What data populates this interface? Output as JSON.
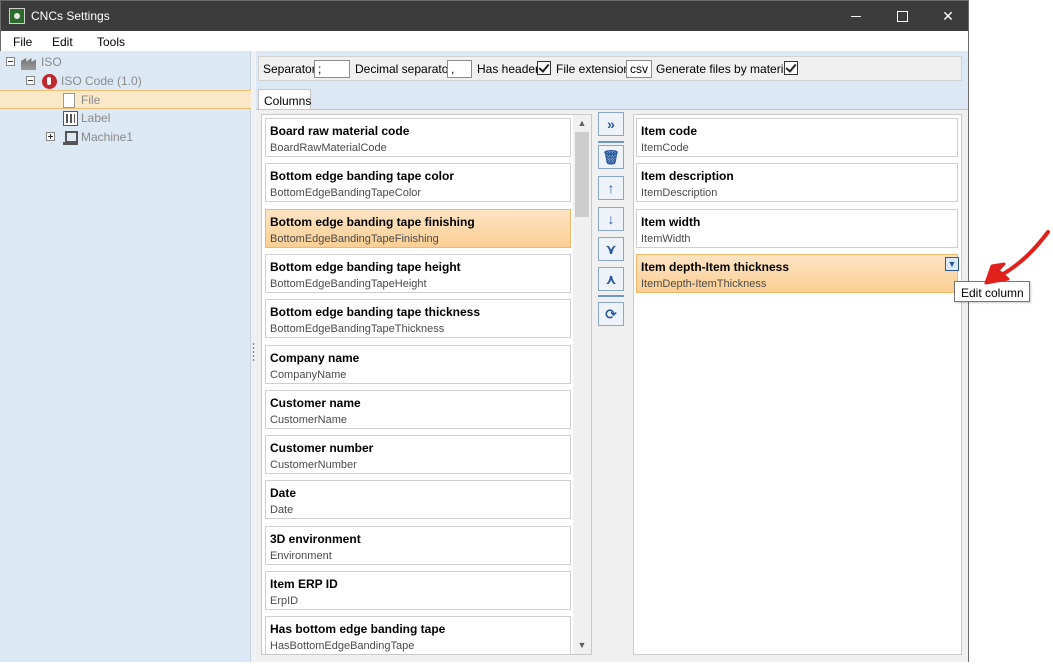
{
  "window": {
    "title": "CNCs Settings"
  },
  "menu": [
    "File",
    "Edit",
    "Tools"
  ],
  "tree": [
    {
      "label": "ISO",
      "icon": "factory-icon"
    },
    {
      "label": "ISO Code (1.0)",
      "icon": "iso-code-icon"
    },
    {
      "label": "File",
      "icon": "file-icon"
    },
    {
      "label": "Label",
      "icon": "label-icon"
    },
    {
      "label": "Machine1",
      "icon": "machine-icon"
    }
  ],
  "toolbar": {
    "separator_label": "Separator",
    "separator_value": ";",
    "decimal_label": "Decimal separator",
    "decimal_value": ",",
    "has_header_label": "Has header",
    "has_header_checked": true,
    "extension_label": "File extension",
    "extension_value": "csv",
    "generate_label": "Generate files by material",
    "generate_checked": true
  },
  "tabs": [
    "Columns"
  ],
  "available_columns": [
    {
      "title": "Board raw material code",
      "key": "BoardRawMaterialCode"
    },
    {
      "title": "Bottom edge banding tape color",
      "key": "BottomEdgeBandingTapeColor"
    },
    {
      "title": "Bottom edge banding tape finishing",
      "key": "BottomEdgeBandingTapeFinishing",
      "selected": true
    },
    {
      "title": "Bottom edge banding tape height",
      "key": "BottomEdgeBandingTapeHeight"
    },
    {
      "title": "Bottom edge banding tape thickness",
      "key": "BottomEdgeBandingTapeThickness"
    },
    {
      "title": "Company name",
      "key": "CompanyName"
    },
    {
      "title": "Customer name",
      "key": "CustomerName"
    },
    {
      "title": "Customer number",
      "key": "CustomerNumber"
    },
    {
      "title": "Date",
      "key": "Date"
    },
    {
      "title": "3D environment",
      "key": "Environment"
    },
    {
      "title": "Item ERP ID",
      "key": "ErpID"
    },
    {
      "title": "Has bottom edge banding tape",
      "key": "HasBottomEdgeBandingTape"
    }
  ],
  "selected_columns": [
    {
      "title": "Item code",
      "key": "ItemCode"
    },
    {
      "title": "Item description",
      "key": "ItemDescription"
    },
    {
      "title": "Item width",
      "key": "ItemWidth"
    },
    {
      "title": "Item depth-Item thickness",
      "key": "ItemDepth-ItemThickness",
      "selected": true
    }
  ],
  "tooltip": {
    "text": "Edit column"
  },
  "colors": {
    "annotation_arrow": "#e0201a",
    "selection": "#fbcf93",
    "titlebar": "#3c3c3c"
  }
}
